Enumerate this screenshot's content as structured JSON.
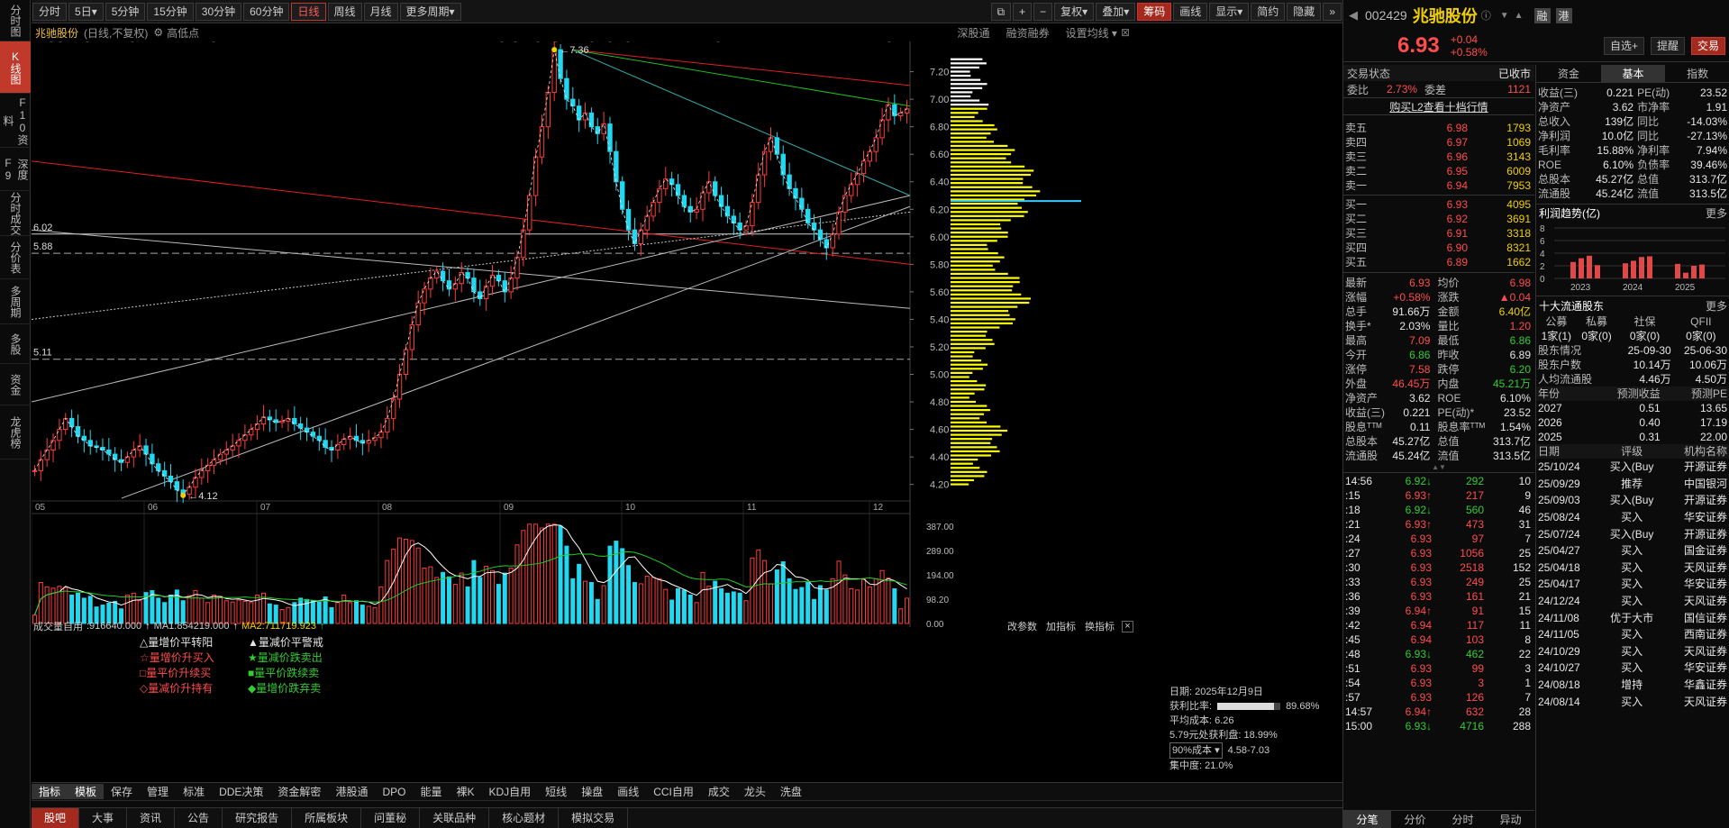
{
  "left_nav": [
    "分时图",
    "K线图",
    "F10资料",
    "深度F9",
    "分时成交",
    "分价表",
    "多周期",
    "多股",
    "资金",
    "龙虎榜"
  ],
  "left_nav_active": 1,
  "toolbar": {
    "periods": [
      "分时",
      "5日▾",
      "5分钟",
      "15分钟",
      "30分钟",
      "60分钟",
      "日线",
      "周线",
      "月线",
      "更多周期▾"
    ],
    "active_period": 6,
    "tools": [
      "⧉",
      "+",
      "−",
      "复权▾",
      "叠加▾",
      "筹码",
      "画线",
      "显示▾",
      "简约",
      "隐藏",
      "»"
    ],
    "active_tool": 5
  },
  "chart_header": {
    "name": "兆驰股份",
    "mode": "(日线,不复权)",
    "gear": "⚙",
    "highlow": "高低点",
    "right_links": [
      "深股通",
      "融资融券",
      "设置均线 ▾"
    ]
  },
  "chart_data": {
    "type": "candlestick",
    "y_ticks": [
      "7.20",
      "7.00",
      "6.80",
      "6.60",
      "6.40",
      "6.20",
      "6.00",
      "5.80",
      "5.60",
      "5.40",
      "5.20",
      "5.00",
      "4.80",
      "4.60",
      "4.40",
      "4.20"
    ],
    "ylim": [
      4.08,
      7.42
    ],
    "x_month_labels": [
      "05",
      "06",
      "07",
      "08",
      "09",
      "10",
      "11",
      "12"
    ],
    "annotations": {
      "high": "7.36",
      "low": "4.12",
      "level1": "6.02",
      "level2": "5.88",
      "level3": "5.11"
    },
    "close_series": [
      4.3,
      4.38,
      4.45,
      4.52,
      4.6,
      4.68,
      4.62,
      4.55,
      4.52,
      4.48,
      4.47,
      4.45,
      4.42,
      4.38,
      4.36,
      4.4,
      4.45,
      4.48,
      4.42,
      4.35,
      4.3,
      4.26,
      4.22,
      4.16,
      4.13,
      4.18,
      4.25,
      4.3,
      4.34,
      4.38,
      4.42,
      4.45,
      4.48,
      4.52,
      4.56,
      4.6,
      4.64,
      4.69,
      4.67,
      4.65,
      4.66,
      4.68,
      4.64,
      4.61,
      4.58,
      4.55,
      4.52,
      4.47,
      4.45,
      4.49,
      4.53,
      4.55,
      4.52,
      4.5,
      4.52,
      4.54,
      4.58,
      4.68,
      4.82,
      5.0,
      5.18,
      5.36,
      5.52,
      5.62,
      5.7,
      5.75,
      5.68,
      5.62,
      5.66,
      5.74,
      5.7,
      5.6,
      5.55,
      5.64,
      5.72,
      5.68,
      5.6,
      5.7,
      5.85,
      6.05,
      6.3,
      6.58,
      6.8,
      7.05,
      7.36,
      7.15,
      7.0,
      6.95,
      6.85,
      6.9,
      6.8,
      6.75,
      6.82,
      6.62,
      6.4,
      6.2,
      6.05,
      5.95,
      6.05,
      6.15,
      6.25,
      6.35,
      6.42,
      6.38,
      6.3,
      6.22,
      6.18,
      6.2,
      6.32,
      6.4,
      6.3,
      6.22,
      6.15,
      6.1,
      6.05,
      6.08,
      6.25,
      6.45,
      6.62,
      6.72,
      6.6,
      6.45,
      6.35,
      6.28,
      6.2,
      6.1,
      6.05,
      5.98,
      5.92,
      6.02,
      6.18,
      6.3,
      6.38,
      6.46,
      6.55,
      6.62,
      6.72,
      6.85,
      6.96,
      6.88,
      6.9,
      6.93
    ],
    "volume": {
      "label": "成交量自用",
      "vol": ":916640.000",
      "ma1": "MA1:854219.000",
      "ma2": "MA2:711719.923",
      "y_ticks": [
        "387.00",
        "289.00",
        "194.00",
        "98.20",
        "0.00"
      ],
      "legend_white": [
        "△量增价平转阳",
        "▲量减价平警戒"
      ],
      "legend_red": [
        "☆量增价升买入",
        "□量平价升续买",
        "◇量减价升持有"
      ],
      "legend_green": [
        "★量减价跌卖出",
        "■量平价跌续卖",
        "◆量增价跌弃卖"
      ],
      "tools": [
        "改参数",
        "加指标",
        "换指标"
      ]
    }
  },
  "chip_info": {
    "date": "日期: 2025年12月9日",
    "profit_label": "获利比率:",
    "profit_ratio": "89.68%",
    "profit_fraction": 0.8968,
    "avg_cost": "平均成本: 6.26",
    "profit_at": "5.79元处获利盘: 18.99%",
    "cost_select": "90%成本 ▾",
    "cost_range": "4.58-7.03",
    "concentration": "集中度: 21.0%"
  },
  "bottom_tabs": [
    "指标",
    "模板",
    "保存",
    "管理",
    "标准",
    "DDE决策",
    "资金解密",
    "港股通",
    "DPO",
    "能量",
    "裸K",
    "KDJ自用",
    "短线",
    "操盘",
    "画线",
    "CCI自用",
    "成交",
    "龙头",
    "洗盘"
  ],
  "bottom_tabs_selected": [
    0,
    1
  ],
  "news_tabs": [
    "股吧",
    "大事",
    "资讯",
    "公告",
    "研究报告",
    "所属板块",
    "问董秘",
    "关联品种",
    "核心题材",
    "模拟交易"
  ],
  "stock": {
    "code": "002429",
    "name": "兆驰股份",
    "tags": [
      "融",
      "港"
    ],
    "price": "6.93",
    "change": "+0.04",
    "change_pct": "+0.58%",
    "buttons": [
      "自选+",
      "提醒",
      "交易"
    ],
    "state_label": "交易状态",
    "state": "已收市",
    "weibi_label": "委比",
    "weibi": "2.73%",
    "weicha_label": "委差",
    "weicha": "1121",
    "l2_link": "购买L2查看十档行情",
    "asks": [
      [
        "卖五",
        "6.98",
        "1793"
      ],
      [
        "卖四",
        "6.97",
        "1069"
      ],
      [
        "卖三",
        "6.96",
        "3143"
      ],
      [
        "卖二",
        "6.95",
        "6009"
      ],
      [
        "卖一",
        "6.94",
        "7953"
      ]
    ],
    "bids": [
      [
        "买一",
        "6.93",
        "4095"
      ],
      [
        "买二",
        "6.92",
        "3691"
      ],
      [
        "买三",
        "6.91",
        "3318"
      ],
      [
        "买四",
        "6.90",
        "8321"
      ],
      [
        "买五",
        "6.89",
        "1662"
      ]
    ],
    "stats": [
      [
        "最新",
        "6.93",
        "up",
        "均价",
        "6.98",
        "up"
      ],
      [
        "涨幅",
        "+0.58%",
        "up",
        "涨跌",
        "▲0.04",
        "up"
      ],
      [
        "总手",
        "91.66万",
        "wh",
        "金额",
        "6.40亿",
        "yl"
      ],
      [
        "换手*",
        "2.03%",
        "wh",
        "量比",
        "1.20",
        "up"
      ],
      [
        "最高",
        "7.09",
        "up",
        "最低",
        "6.86",
        "dn"
      ],
      [
        "今开",
        "6.86",
        "dn",
        "昨收",
        "6.89",
        "wh"
      ],
      [
        "涨停",
        "7.58",
        "up",
        "跌停",
        "6.20",
        "dn"
      ],
      [
        "外盘",
        "46.45万",
        "up",
        "内盘",
        "45.21万",
        "dn"
      ],
      [
        "净资产",
        "3.62",
        "wh",
        "ROE",
        "6.10%",
        "wh"
      ],
      [
        "收益(三)",
        "0.221",
        "wh",
        "PE(动)*",
        "23.52",
        "wh"
      ],
      [
        "股息ᵀᵀᴹ",
        "0.11",
        "wh",
        "股息率ᵀᵀᴹ",
        "1.54%",
        "wh"
      ],
      [
        "总股本",
        "45.27亿",
        "wh",
        "总值",
        "313.7亿",
        "wh"
      ],
      [
        "流通股",
        "45.24亿",
        "wh",
        "流值",
        "313.5亿",
        "wh"
      ]
    ],
    "ticks": [
      [
        "14:56",
        "6.92",
        "dn",
        "↓",
        "292",
        "10"
      ],
      [
        ":15",
        "6.93",
        "up",
        "↑",
        "217",
        "9"
      ],
      [
        ":18",
        "6.92",
        "dn",
        "↓",
        "560",
        "46"
      ],
      [
        ":21",
        "6.93",
        "up",
        "↑",
        "473",
        "31"
      ],
      [
        ":24",
        "6.93",
        "up",
        "",
        "97",
        "7"
      ],
      [
        ":27",
        "6.93",
        "up",
        "",
        "1056",
        "25"
      ],
      [
        ":30",
        "6.93",
        "up",
        "",
        "2518",
        "152"
      ],
      [
        ":33",
        "6.93",
        "up",
        "",
        "249",
        "25"
      ],
      [
        ":36",
        "6.93",
        "up",
        "",
        "161",
        "21"
      ],
      [
        ":39",
        "6.94",
        "up",
        "↑",
        "91",
        "15"
      ],
      [
        ":42",
        "6.94",
        "up",
        "",
        "117",
        "11"
      ],
      [
        ":45",
        "6.94",
        "up",
        "",
        "103",
        "8"
      ],
      [
        ":48",
        "6.93",
        "dn",
        "↓",
        "462",
        "22"
      ],
      [
        ":51",
        "6.93",
        "up",
        "",
        "99",
        "3"
      ],
      [
        ":54",
        "6.93",
        "up",
        "",
        "3",
        "1"
      ],
      [
        ":57",
        "6.93",
        "up",
        "",
        "126",
        "7"
      ],
      [
        "14:57",
        "6.94",
        "up",
        "↑",
        "632",
        "28"
      ],
      [
        "15:00",
        "6.93",
        "dn",
        "↓",
        "4716",
        "288"
      ]
    ],
    "tick_tabs": [
      "分笔",
      "分价",
      "分时",
      "异动"
    ],
    "tick_tab_active": 0
  },
  "fundamentals": {
    "tabs": [
      "资金",
      "基本",
      "指数"
    ],
    "active_tab": 1,
    "rows": [
      [
        "收益(三)",
        "0.221",
        "PE(动)",
        "23.52"
      ],
      [
        "净资产",
        "3.62",
        "市净率",
        "1.91"
      ],
      [
        "总收入",
        "139亿",
        "同比",
        "-14.03%"
      ],
      [
        "净利润",
        "10.0亿",
        "同比",
        "-27.13%"
      ],
      [
        "毛利率",
        "15.88%",
        "净利率",
        "7.94%"
      ],
      [
        "ROE",
        "6.10%",
        "负债率",
        "39.46%"
      ],
      [
        "总股本",
        "45.27亿",
        "总值",
        "313.7亿"
      ],
      [
        "流通股",
        "45.24亿",
        "流值",
        "313.5亿"
      ]
    ],
    "profit_title": "利润趋势(亿)",
    "more": "更多",
    "profit_y": [
      "8",
      "6",
      "4",
      "2",
      "0"
    ],
    "profit_years": [
      "2023",
      "2024",
      "2025"
    ],
    "profit_bars": [
      2.6,
      3.2,
      3.6,
      2.1,
      2.4,
      2.8,
      3.4,
      3.5,
      2.3,
      0.9,
      2.0,
      2.2
    ],
    "holders_title": "十大流通股东",
    "holders_types": [
      "公募",
      "私募",
      "社保",
      "QFII"
    ],
    "holders_counts": [
      "1家(1)",
      "0家(0)",
      "0家(0)",
      "0家(0)"
    ],
    "holders_rows": [
      [
        "股东情况",
        "25-09-30",
        "25-06-30"
      ],
      [
        "股东户数",
        "10.14万",
        "10.06万"
      ],
      [
        "人均流通股",
        "4.46万",
        "4.50万"
      ]
    ],
    "forecast_header": [
      "年份",
      "预测收益",
      "预测PE"
    ],
    "forecast_rows": [
      [
        "2027",
        "0.51",
        "13.65"
      ],
      [
        "2026",
        "0.40",
        "17.19"
      ],
      [
        "2025",
        "0.31",
        "22.00"
      ]
    ],
    "rating_header": [
      "日期",
      "评级",
      "机构名称"
    ],
    "ratings": [
      [
        "25/10/24",
        "买入(Buy",
        "开源证券"
      ],
      [
        "25/09/29",
        "推荐",
        "中国银河"
      ],
      [
        "25/09/03",
        "买入(Buy",
        "开源证券"
      ],
      [
        "25/08/24",
        "买入",
        "华安证券"
      ],
      [
        "25/07/24",
        "买入(Buy",
        "开源证券"
      ],
      [
        "25/04/27",
        "买入",
        "国金证券"
      ],
      [
        "25/04/18",
        "买入",
        "天风证券"
      ],
      [
        "25/04/17",
        "买入",
        "华安证券"
      ],
      [
        "24/12/24",
        "买入",
        "天风证券"
      ],
      [
        "24/11/08",
        "优于大市",
        "国信证券"
      ],
      [
        "24/11/05",
        "买入",
        "西南证券"
      ],
      [
        "24/10/29",
        "买入",
        "天风证券"
      ],
      [
        "24/10/27",
        "买入",
        "华安证券"
      ],
      [
        "24/08/18",
        "增持",
        "华鑫证券"
      ],
      [
        "24/08/14",
        "买入",
        "天风证券"
      ]
    ]
  }
}
